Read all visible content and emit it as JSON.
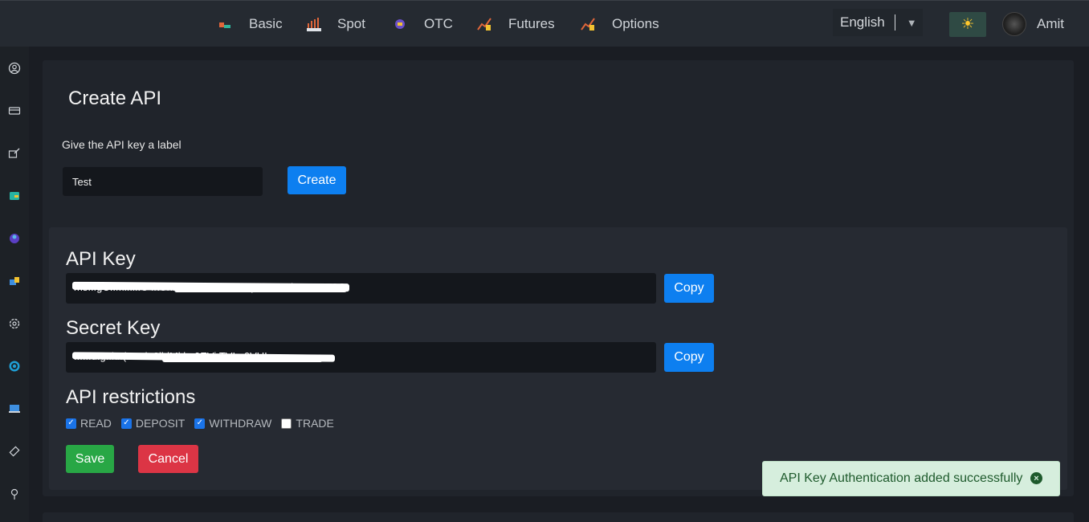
{
  "topbar": {
    "nav": [
      {
        "label": "Basic",
        "icon": "basic-icon"
      },
      {
        "label": "Spot",
        "icon": "spot-icon"
      },
      {
        "label": "OTC",
        "icon": "otc-icon"
      },
      {
        "label": "Futures",
        "icon": "futures-icon"
      },
      {
        "label": "Options",
        "icon": "options-icon"
      }
    ],
    "language": "English",
    "theme_icon": "sun-icon",
    "user_name": "Amit"
  },
  "sidebar": {
    "icons": [
      "profile-icon",
      "card-icon",
      "edit-icon",
      "wallet-icon",
      "globe-icon",
      "transfer-icon",
      "settings-icon",
      "target-icon",
      "api-icon",
      "ticket-icon",
      "location-icon"
    ]
  },
  "create": {
    "title": "Create API",
    "label_prompt": "Give the API key a label",
    "label_value": "Test",
    "create_button": "Create"
  },
  "keys": {
    "api_key_heading": "API Key",
    "api_key_value": "ms...gC..Ml..l..C4kCniMVWCV24KSPqvLcW87kUwBXK2C",
    "secret_key_heading": "Secret Key",
    "secret_key_value": "......u.g..k..(...v..l..2iidMklm0EVi.TVI...0VUL",
    "copy_label": "Copy"
  },
  "restrictions": {
    "heading": "API restrictions",
    "options": [
      {
        "label": "READ",
        "checked": true
      },
      {
        "label": "DEPOSIT",
        "checked": true
      },
      {
        "label": "WITHDRAW",
        "checked": true
      },
      {
        "label": "TRADE",
        "checked": false
      }
    ],
    "save_label": "Save",
    "cancel_label": "Cancel"
  },
  "toast": {
    "message": "API Key Authentication added successfully"
  },
  "colors": {
    "primary": "#0d7ff0",
    "success": "#28a745",
    "danger": "#dc3545",
    "toast_bg": "#d6eedd"
  }
}
